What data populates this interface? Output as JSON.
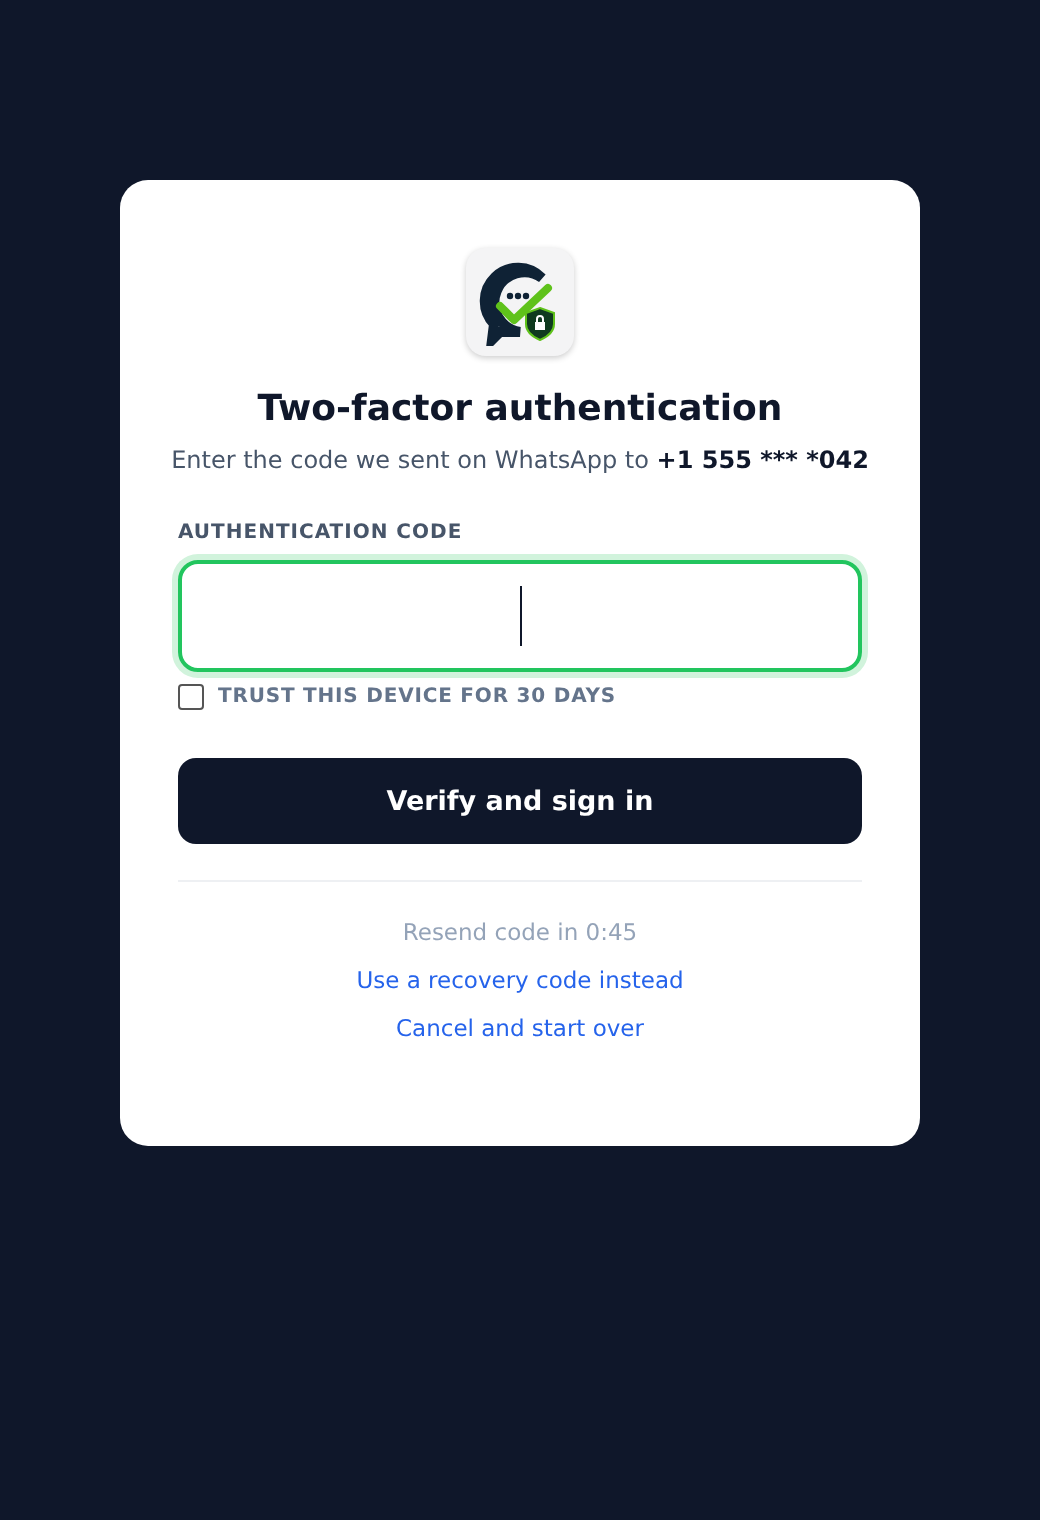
{
  "title": "Two-factor authentication",
  "subtitle": "Enter the code we sent on WhatsApp to",
  "phone": "+1 555 *** *042",
  "code_field": {
    "label": "AUTHENTICATION CODE",
    "focused": true
  },
  "trust_device": {
    "label": "TRUST THIS DEVICE FOR 30 DAYS",
    "checked": false
  },
  "submit": "Verify and sign in",
  "resend": "Resend code in 0:45",
  "links": [
    "Use a recovery code instead",
    "Cancel and start over"
  ]
}
